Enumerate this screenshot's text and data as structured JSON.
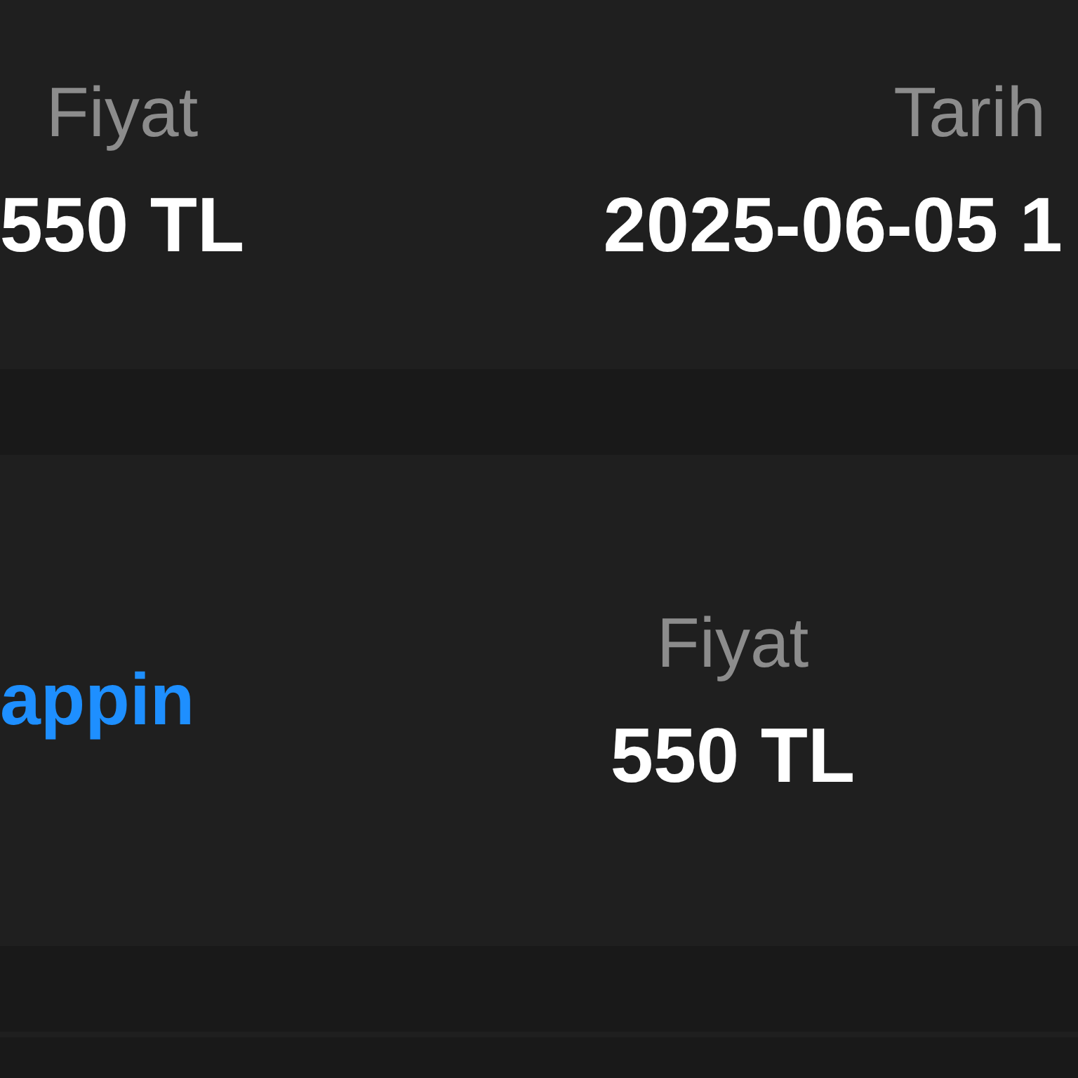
{
  "cards": [
    {
      "kind": "stats",
      "fields": [
        {
          "kind": "stat",
          "label": "Fiyat",
          "value": "550 TL"
        },
        {
          "kind": "stat",
          "label": "Tarih",
          "value": "2025-06-05 1"
        }
      ]
    },
    {
      "kind": "item",
      "fields": [
        {
          "kind": "title",
          "text": "appin"
        },
        {
          "kind": "stat",
          "label": "Fiyat",
          "value": "550 TL"
        }
      ]
    }
  ]
}
